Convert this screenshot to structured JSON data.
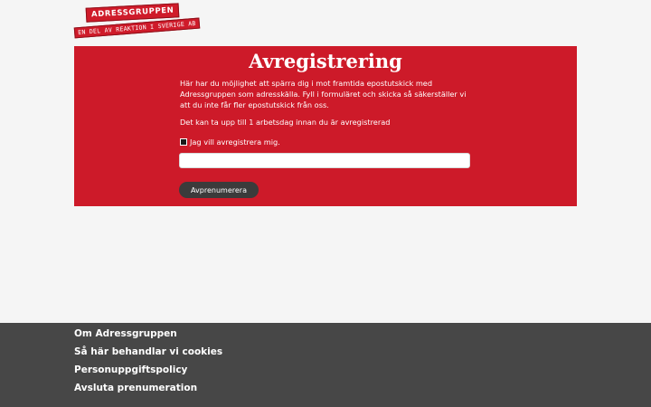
{
  "logo": {
    "top": "ADRESSGRUPPEN",
    "bottom": "EN DEL AV REAKTION I SVERIGE AB"
  },
  "form": {
    "title": "Avregistrering",
    "paragraph1": "Här har du möjlighet att spärra dig i mot framtida epostutskick med Adressgruppen som adresskälla. Fyll i formuläret och skicka så säkerställer vi att du inte får fler epostutskick från oss.",
    "paragraph2": "Det kan ta upp till 1 arbetsdag innan du är avregistrerad",
    "checkbox_label": "Jag vill avregistrera mig.",
    "checkbox_checked": true,
    "email_value": "",
    "submit_label": "Avprenumerera"
  },
  "footer": {
    "links": [
      "Om Adressgruppen",
      "Så här behandlar vi cookies",
      "Personuppgiftspolicy",
      "Avsluta prenumeration"
    ]
  },
  "colors": {
    "brand_red": "#cd1a29",
    "footer_bg": "#474747",
    "button_bg": "#3b3b3b",
    "page_bg": "#f5f5f5"
  }
}
